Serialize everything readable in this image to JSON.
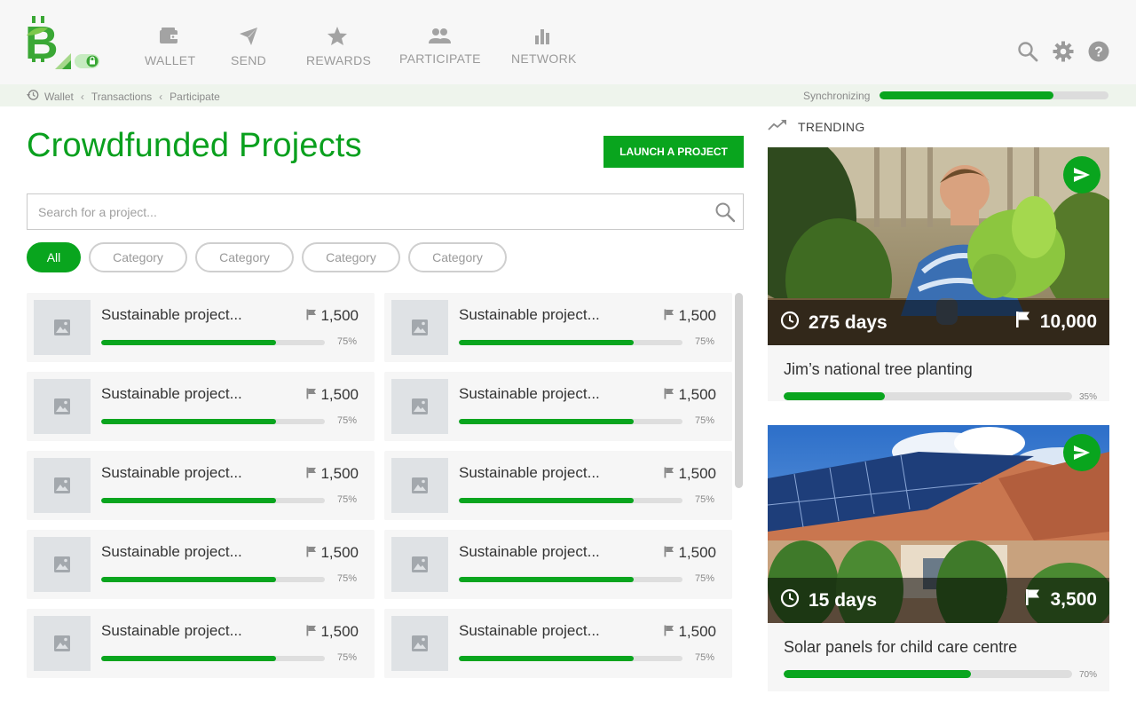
{
  "colors": {
    "accent": "#09a51e",
    "header_bg": "#f7f7f7",
    "crumb_bg": "#eef4ec"
  },
  "nav": [
    {
      "label": "WALLET",
      "icon": "wallet-icon"
    },
    {
      "label": "SEND",
      "icon": "send-icon"
    },
    {
      "label": "REWARDS",
      "icon": "star-icon"
    },
    {
      "label": "PARTICIPATE",
      "icon": "people-icon"
    },
    {
      "label": "NETWORK",
      "icon": "bar-chart-icon"
    }
  ],
  "header_icons": [
    "search-icon",
    "gear-icon",
    "help-icon"
  ],
  "breadcrumb": [
    "Wallet",
    "Transactions",
    "Participate"
  ],
  "sync": {
    "label": "Synchronizing",
    "progress": 0.76
  },
  "main": {
    "title": "Crowdfunded Projects",
    "launch_label": "LAUNCH A PROJECT",
    "search_placeholder": "Search for a project..."
  },
  "filters": [
    "All",
    "Category",
    "Category",
    "Category",
    "Category"
  ],
  "projects": [
    {
      "title": "Sustainable project...",
      "goal": "1,500",
      "percent": "75%",
      "progress": 0.78
    },
    {
      "title": "Sustainable project...",
      "goal": "1,500",
      "percent": "75%",
      "progress": 0.78
    },
    {
      "title": "Sustainable project...",
      "goal": "1,500",
      "percent": "75%",
      "progress": 0.78
    },
    {
      "title": "Sustainable project...",
      "goal": "1,500",
      "percent": "75%",
      "progress": 0.78
    },
    {
      "title": "Sustainable project...",
      "goal": "1,500",
      "percent": "75%",
      "progress": 0.78
    },
    {
      "title": "Sustainable project...",
      "goal": "1,500",
      "percent": "75%",
      "progress": 0.78
    },
    {
      "title": "Sustainable project...",
      "goal": "1,500",
      "percent": "75%",
      "progress": 0.78
    },
    {
      "title": "Sustainable project...",
      "goal": "1,500",
      "percent": "75%",
      "progress": 0.78
    },
    {
      "title": "Sustainable project...",
      "goal": "1,500",
      "percent": "75%",
      "progress": 0.78
    },
    {
      "title": "Sustainable project...",
      "goal": "1,500",
      "percent": "75%",
      "progress": 0.78
    }
  ],
  "trending": {
    "label": "TRENDING",
    "items": [
      {
        "title": "Jim’s national tree planting",
        "days": "275 days",
        "goal": "10,000",
        "percent": "35%",
        "progress": 0.35
      },
      {
        "title": "Solar panels for child care centre",
        "days": "15 days",
        "goal": "3,500",
        "percent": "70%",
        "progress": 0.65
      }
    ]
  }
}
